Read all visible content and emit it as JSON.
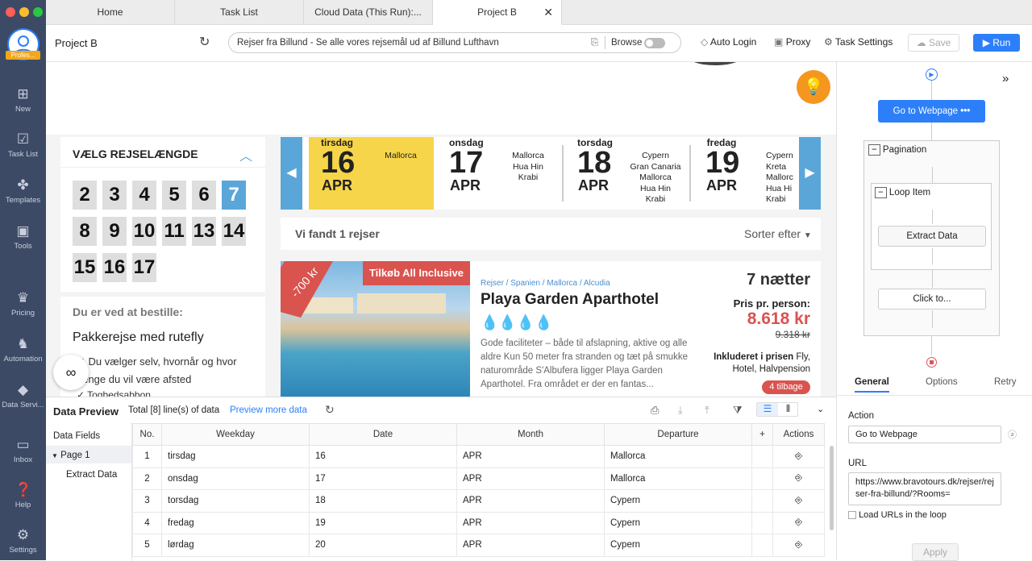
{
  "window": {
    "dot_colors": [
      "#ff5f57",
      "#febc2e",
      "#28c840"
    ]
  },
  "sidebar": {
    "logo_tag": "Profes...",
    "items": [
      {
        "label": "New",
        "icon": "plus-box-icon"
      },
      {
        "label": "Task List",
        "icon": "check-box-icon"
      },
      {
        "label": "Templates",
        "icon": "puzzle-icon"
      },
      {
        "label": "Tools",
        "icon": "toolbox-icon"
      },
      {
        "label": "Pricing",
        "icon": "crown-icon"
      },
      {
        "label": "Automation",
        "icon": "robot-icon"
      },
      {
        "label": "Data Servi...",
        "icon": "diamond-icon"
      },
      {
        "label": "Inbox",
        "icon": "inbox-icon"
      },
      {
        "label": "Help",
        "icon": "help-icon"
      },
      {
        "label": "Settings",
        "icon": "gear-icon"
      }
    ]
  },
  "tabs": [
    "Home",
    "Task List",
    "Cloud Data (This Run):...",
    "Project B"
  ],
  "toolbar": {
    "project": "Project B",
    "url": "Rejser fra Billund - Se alle vores rejsemål ud af Billund Lufthavn",
    "browse": "Browse",
    "auto_login": "Auto Login",
    "proxy": "Proxy",
    "task_settings": "Task Settings",
    "save": "Save",
    "run": "Run"
  },
  "webpage": {
    "filter_title": "VÆLG REJSELÆNGDE",
    "durations": [
      "2",
      "3",
      "4",
      "5",
      "6",
      "7",
      "8",
      "9",
      "10",
      "11",
      "13",
      "14",
      "15",
      "16",
      "17"
    ],
    "selected_duration": "7",
    "booking_title": "Du er ved at bestille:",
    "booking_type": "Pakkerejse med rutefly",
    "booking_item1": "Du vælger selv, hvornår og hvor længe du vil være afsted",
    "booking_item2": "Togbedsabbon",
    "dates": [
      {
        "weekday": "tirsdag",
        "day": "16",
        "month": "APR",
        "dests": [
          "Mallorca"
        ]
      },
      {
        "weekday": "onsdag",
        "day": "17",
        "month": "APR",
        "dests": [
          "Mallorca",
          "Hua Hin",
          "Krabi"
        ]
      },
      {
        "weekday": "torsdag",
        "day": "18",
        "month": "APR",
        "dests": [
          "Cypern",
          "Gran Canaria",
          "Mallorca",
          "Hua Hin",
          "Krabi"
        ]
      },
      {
        "weekday": "fredag",
        "day": "19",
        "month": "APR",
        "dests": [
          "Cypern",
          "Kreta",
          "Mallorc",
          "Hua Hi",
          "Krabi"
        ]
      }
    ],
    "found": "Vi fandt 1 rejser",
    "sort": "Sorter efter",
    "ribbon": "-700 kr",
    "offer_badge": "Tilkøb All Inclusive",
    "breadcrumb": [
      "Rejser",
      "Spanien",
      "Mallorca",
      "Alcudia"
    ],
    "hotel": "Playa Garden Aparthotel",
    "description": "Gode faciliteter – både til afslapning, aktive og alle aldre Kun 50 meter fra stranden og tæt på smukke naturområde S'Albufera ligger Playa Garden Aparthotel. Fra området er der en fantas...",
    "nights": "7 nætter",
    "price_label": "Pris pr. person:",
    "price": "8.618 kr",
    "old_price": "9.318 kr",
    "included_label": "Inkluderet i prisen",
    "included_text": "Fly, Hotel, Halvpension",
    "remaining": "4 tilbage"
  },
  "preview": {
    "title": "Data Preview",
    "total": "Total [8] line(s) of data",
    "more": "Preview more data",
    "fields": "Data Fields",
    "page": "Page 1",
    "extract": "Extract Data",
    "columns": [
      "No.",
      "Weekday",
      "Date",
      "Month",
      "Departure",
      "+",
      "Actions"
    ],
    "rows": [
      [
        "1",
        "tirsdag",
        "16",
        "APR",
        "Mallorca"
      ],
      [
        "2",
        "onsdag",
        "17",
        "APR",
        "Mallorca"
      ],
      [
        "3",
        "torsdag",
        "18",
        "APR",
        "Cypern"
      ],
      [
        "4",
        "fredag",
        "19",
        "APR",
        "Cypern"
      ],
      [
        "5",
        "lørdag",
        "20",
        "APR",
        "Cypern"
      ]
    ]
  },
  "workflow": {
    "go": "Go to Webpage",
    "pagination": "Pagination",
    "loop": "Loop Item",
    "extract": "Extract Data",
    "click": "Click to..."
  },
  "settings": {
    "tabs": [
      "General",
      "Options",
      "Retry"
    ],
    "action_label": "Action",
    "action_value": "Go to Webpage",
    "url_label": "URL",
    "url_value": "https://www.bravotours.dk/rejser/rejser-fra-billund/?Rooms=",
    "loop_label": "Load URLs in the loop",
    "apply": "Apply"
  }
}
